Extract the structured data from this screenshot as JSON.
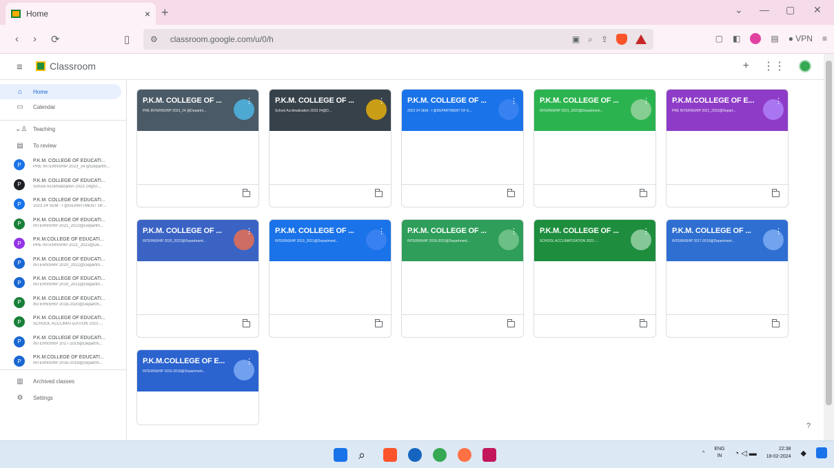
{
  "browser": {
    "tab_title": "Home",
    "tab_close": "×",
    "new_tab": "+",
    "url": "classroom.google.com/u/0/h",
    "vpn_label": "VPN",
    "window_min": "—",
    "window_max": "▢",
    "window_close": "✕"
  },
  "app": {
    "title": "Classroom"
  },
  "sidebar": {
    "home": "Home",
    "calendar": "Calendar",
    "teaching": "Teaching",
    "to_review": "To review",
    "archived": "Archived classes",
    "settings": "Settings",
    "classes": [
      {
        "name": "P.K.M. COLLEGE OF EDUCATI...",
        "sub": "PRE INTERNSHIP 2023_24 @Departm...",
        "color": "#1a73e8",
        "initial": "P"
      },
      {
        "name": "P.K.M. COLLEGE OF EDUCATI...",
        "sub": "School Acclimatization 2023 24@D...",
        "color": "#202124",
        "initial": "P"
      },
      {
        "name": "P.K.M. COLLEGE OF EDUCATI...",
        "sub": "2023 24 SEM - I @DEPARTMENT OF...",
        "color": "#1a73e8",
        "initial": "P"
      },
      {
        "name": "P.K.M. COLLEGE OF EDUCATI...",
        "sub": "INTERNSHIP 2021_2022@Departm...",
        "color": "#188038",
        "initial": "P"
      },
      {
        "name": "P.K.M.COLLEGE OF EDUCATI...",
        "sub": "PRE INTERNSHIP 2021_2022@De...",
        "color": "#9334e6",
        "initial": "P"
      },
      {
        "name": "P.K.M. COLLEGE OF EDUCATI...",
        "sub": "INTERNSHIP 2020_2022@Departm...",
        "color": "#1967d2",
        "initial": "P"
      },
      {
        "name": "P.K.M. COLLEGE OF EDUCATI...",
        "sub": "INTERNSHIP 2019_2021@Departm...",
        "color": "#1967d2",
        "initial": "P"
      },
      {
        "name": "P.K.M. COLLEGE OF EDUCATI...",
        "sub": "INTERNSHIP 2018-2020@Departm...",
        "color": "#188038",
        "initial": "P"
      },
      {
        "name": "P.K.M. COLLEGE OF EDUCATI...",
        "sub": "SCHOOL ACCLIMATIZATION 2021-...",
        "color": "#188038",
        "initial": "P"
      },
      {
        "name": "P.K.M. COLLEGE OF EDUCATI...",
        "sub": "INTERNSHIP 2017-2019@Departm...",
        "color": "#1967d2",
        "initial": "P"
      },
      {
        "name": "P.K.M.COLLEGE OF EDUCATI...",
        "sub": "INTERNSHIP 2016-2018@Departm...",
        "color": "#1967d2",
        "initial": "P"
      }
    ]
  },
  "cards": [
    {
      "name": "P.K.M. COLLEGE OF ...",
      "sub": "PRE INTERNSHIP 2023_24 @Departm...",
      "bg": "#4a5a66",
      "deco": "#4fc3f7"
    },
    {
      "name": "P.K.M. COLLEGE OF ...",
      "sub": "School Acclimatization 2023 24@D...",
      "bg": "#37414a",
      "deco": "#fbbc04"
    },
    {
      "name": "P.K.M. COLLEGE OF ...",
      "sub": "2023 24 SEM - I @DEPARTMENT OF E...",
      "bg": "#1a73e8",
      "deco": "#4285f4"
    },
    {
      "name": "P.K.M. COLLEGE OF ...",
      "sub": "INTERNSHIP 2021_2022@Department...",
      "bg": "#2bb34f",
      "deco": "#a5d6a7"
    },
    {
      "name": "P.K.M.COLLEGE OF E...",
      "sub": "PRE INTERNSHIP 2021_2022@Depart...",
      "bg": "#8e3cc7",
      "deco": "#b388ff"
    },
    {
      "name": "P.K.M. COLLEGE OF ...",
      "sub": "INTERNSHIP 2020_2022@Department...",
      "bg": "#3a63c4",
      "deco": "#ff7043"
    },
    {
      "name": "P.K.M. COLLEGE OF ...",
      "sub": "INTERNSHIP 2019_2021@Department...",
      "bg": "#1a73e8",
      "deco": "#4285f4"
    },
    {
      "name": "P.K.M. COLLEGE OF ...",
      "sub": "INTERNSHIP 2018-2020@Department...",
      "bg": "#2e9e5a",
      "deco": "#81c995"
    },
    {
      "name": "P.K.M. COLLEGE OF ...",
      "sub": "SCHOOL ACCLIMATIZATION 2021-...",
      "bg": "#1e8e3e",
      "deco": "#a8dab5"
    },
    {
      "name": "P.K.M. COLLEGE OF ...",
      "sub": "INTERNSHIP 2017-2019@Department...",
      "bg": "#2f6fd1",
      "deco": "#8ab4f8"
    },
    {
      "name": "P.K.M.COLLEGE OF E...",
      "sub": "INTERNSHIP 2016-2018@Department...",
      "bg": "#2b63cf",
      "deco": "#8ab4f8"
    }
  ],
  "taskbar": {
    "lang": "ENG",
    "lang2": "IN",
    "time": "22:38",
    "date": "18-02-2024"
  }
}
